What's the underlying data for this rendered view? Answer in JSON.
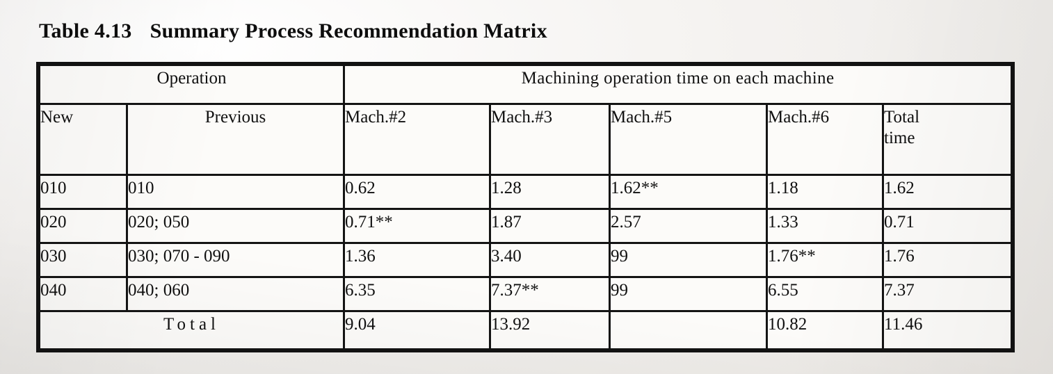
{
  "caption": {
    "label": "Table 4.13",
    "title": "Summary Process Recommendation Matrix"
  },
  "table": {
    "group_headers": {
      "operation": "Operation",
      "machining": "Machining  operation  time  on each machine"
    },
    "columns": [
      {
        "key": "new",
        "label": "New"
      },
      {
        "key": "prev",
        "label": "Previous"
      },
      {
        "key": "m2",
        "label": "Mach.#2"
      },
      {
        "key": "m3",
        "label": "Mach.#3"
      },
      {
        "key": "m5",
        "label": "Mach.#5"
      },
      {
        "key": "m6",
        "label": "Mach.#6"
      },
      {
        "key": "total",
        "label_line1": "Total",
        "label_line2": "time"
      }
    ],
    "rows": [
      {
        "new": "010",
        "prev": "010",
        "m2": "0.62",
        "m3": "1.28",
        "m5": "1.62**",
        "m6": "1.18",
        "total": "1.62"
      },
      {
        "new": "020",
        "prev": "020; 050",
        "m2": "0.71**",
        "m3": "1.87",
        "m5": "2.57",
        "m6": "1.33",
        "total": "0.71"
      },
      {
        "new": "030",
        "prev": "030; 070 - 090",
        "m2": "1.36",
        "m3": "3.40",
        "m5": "99",
        "m6": "1.76**",
        "total": "1.76"
      },
      {
        "new": "040",
        "prev": "040; 060",
        "m2": "6.35",
        "m3": "7.37**",
        "m5": "99",
        "m6": "6.55",
        "total": "7.37"
      }
    ],
    "total_row": {
      "label": "Total",
      "m2": "9.04",
      "m3": "13.92",
      "m5": "",
      "m6": "10.82",
      "total": "11.46"
    }
  }
}
